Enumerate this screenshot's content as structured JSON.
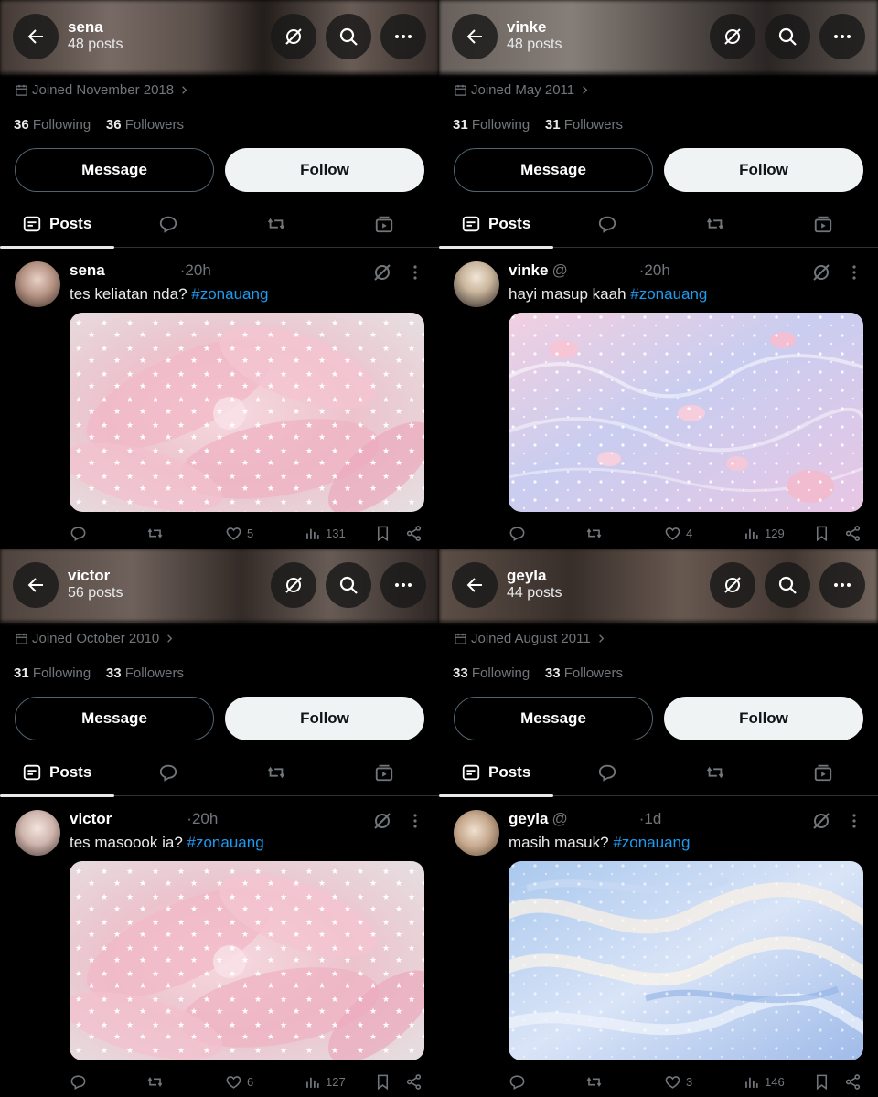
{
  "panels": [
    {
      "header": {
        "name": "sena",
        "posts": "48 posts"
      },
      "joined": "Joined November 2018",
      "following_count": "36",
      "following_label": "Following",
      "followers_count": "36",
      "followers_label": "Followers",
      "message_label": "Message",
      "follow_label": "Follow",
      "tab_posts": "Posts",
      "post": {
        "name": "sena",
        "handle": "",
        "time": "20h",
        "text": "tes keliatan nda? ",
        "hashtag": "#zonauang",
        "likes": "5",
        "views": "131"
      },
      "media": "pink-lily-stars"
    },
    {
      "header": {
        "name": "vinke",
        "posts": "48 posts"
      },
      "joined": "Joined May 2011",
      "following_count": "31",
      "following_label": "Following",
      "followers_count": "31",
      "followers_label": "Followers",
      "message_label": "Message",
      "follow_label": "Follow",
      "tab_posts": "Posts",
      "post": {
        "name": "vinke",
        "handle": "@",
        "time": "20h",
        "text": "hayi masup kaah ",
        "hashtag": "#zonauang",
        "likes": "4",
        "views": "129"
      },
      "media": "sparkly-water-petals"
    },
    {
      "header": {
        "name": "victor",
        "posts": "56 posts"
      },
      "joined": "Joined October 2010",
      "following_count": "31",
      "following_label": "Following",
      "followers_count": "33",
      "followers_label": "Followers",
      "message_label": "Message",
      "follow_label": "Follow",
      "tab_posts": "Posts",
      "post": {
        "name": "victor",
        "handle": "",
        "time": "20h",
        "text": "tes masoook ia? ",
        "hashtag": "#zonauang",
        "likes": "6",
        "views": "127"
      },
      "media": "pink-lily-stars"
    },
    {
      "header": {
        "name": "geyla",
        "posts": "44 posts"
      },
      "joined": "Joined August 2011",
      "following_count": "33",
      "following_label": "Following",
      "followers_count": "33",
      "followers_label": "Followers",
      "message_label": "Message",
      "follow_label": "Follow",
      "tab_posts": "Posts",
      "post": {
        "name": "geyla",
        "handle": "@",
        "time": "1d",
        "text": "masih masuk? ",
        "hashtag": "#zonauang",
        "likes": "3",
        "views": "146"
      },
      "media": "blue-swirl-sky"
    }
  ],
  "colors": {
    "background": "#000000",
    "text": "#e7e9ea",
    "muted": "#71767b",
    "link": "#1d9bf0",
    "follow_bg": "#eff3f4",
    "border": "#2f3336"
  }
}
